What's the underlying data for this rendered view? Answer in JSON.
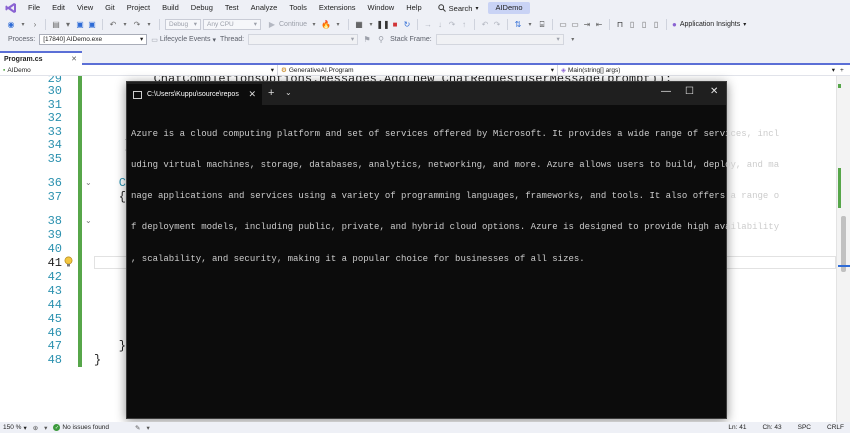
{
  "menu": {
    "items": [
      "File",
      "Edit",
      "View",
      "Git",
      "Project",
      "Build",
      "Debug",
      "Test",
      "Analyze",
      "Tools",
      "Extensions",
      "Window",
      "Help"
    ],
    "search_label": "Search",
    "solution_name": "AIDemo"
  },
  "toolbar": {
    "config_combo": "Debug",
    "platform_combo": "Any CPU",
    "continue_label": "Continue",
    "insights_label": "Application Insights"
  },
  "debugbar": {
    "process_label": "Process:",
    "process_value": "[17840] AIDemo.exe",
    "lifecycle_label": "Lifecycle Events",
    "thread_label": "Thread:",
    "stackframe_label": "Stack Frame:"
  },
  "document": {
    "tab_name": "Program.cs",
    "nav_project": "AIDemo",
    "nav_class": "GenerativeAI.Program",
    "nav_member": "Main(string[] args)"
  },
  "editor": {
    "lines": [
      {
        "num": "29",
        "code": "        ChatCompletionsOptions.Messages.Add(new ChatRequestUserMessage(prompt));"
      },
      {
        "num": "30",
        "code": ""
      },
      {
        "num": "31",
        "code": ""
      },
      {
        "num": "32",
        "code": ""
      },
      {
        "num": "33",
        "code": ""
      },
      {
        "num": "34",
        "code": "    }"
      },
      {
        "num": "35",
        "code": ""
      },
      {
        "num": "36",
        "code": "    C"
      },
      {
        "num": "37",
        "code": "    {"
      },
      {
        "num": "38",
        "code": ""
      },
      {
        "num": "39",
        "code": ""
      },
      {
        "num": "40",
        "code": ""
      },
      {
        "num": "41",
        "code": ""
      },
      {
        "num": "42",
        "code": ""
      },
      {
        "num": "43",
        "code": ""
      },
      {
        "num": "44",
        "code": ""
      },
      {
        "num": "45",
        "code": ""
      },
      {
        "num": "46",
        "code": ""
      },
      {
        "num": "47",
        "code": "    }"
      },
      {
        "num": "48",
        "code": "}"
      }
    ],
    "current_line": "41",
    "line_34_extra": "0",
    "line_35_extra": "0"
  },
  "terminal": {
    "tab_title": "C:\\Users\\Kuppu\\source\\repos",
    "output_lines": [
      "Azure is a cloud computing platform and set of services offered by Microsoft. It provides a wide range of services, incl",
      "uding virtual machines, storage, databases, analytics, networking, and more. Azure allows users to build, deploy, and ma",
      "nage applications and services using a variety of programming languages, frameworks, and tools. It also offers a range o",
      "f deployment models, including public, private, and hybrid cloud options. Azure is designed to provide high availability",
      ", scalability, and security, making it a popular choice for businesses of all sizes."
    ]
  },
  "statusbar": {
    "zoom": "150 %",
    "issues": "No issues found",
    "line": "Ln: 41",
    "col": "Ch: 43",
    "whitespace": "SPC",
    "line_ending": "CRLF"
  }
}
